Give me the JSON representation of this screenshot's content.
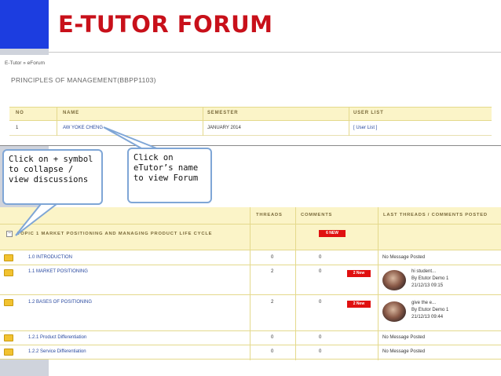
{
  "slide": {
    "title": "E-TUTOR FORUM"
  },
  "forum_page": {
    "breadcrumb": "E-Tutor » eForum",
    "course_title": "PRINCIPLES OF MANAGEMENT(BBPP1103)",
    "columns": [
      "NO",
      "NAME",
      "SEMESTER",
      "USER LIST"
    ],
    "rows": [
      {
        "no": "1",
        "name": "AW YOKE CHENG",
        "semester": "JANUARY 2014",
        "user_list": "[ User List ]"
      }
    ]
  },
  "topic_page": {
    "columns": {
      "threads": "THREADS",
      "comments": "COMMENTS",
      "last": "LAST THREADS / COMMENTS POSTED"
    },
    "topic": {
      "label": "TOPIC 1 MARKET POSITIONING AND MANAGING PRODUCT LIFE CYCLE",
      "badge": "6 NEW"
    },
    "subtopics": [
      {
        "name": "1.0 INTRODUCTION",
        "threads": "0",
        "comments": "0",
        "badge": "",
        "last": [
          "No Message Posted"
        ]
      },
      {
        "name": "1.1 MARKET POSITIONING",
        "threads": "2",
        "comments": "0",
        "badge": "2 New",
        "last": [
          "hi student...",
          "By Etutor Demo 1",
          "21/12/13 09:15"
        ]
      },
      {
        "name": "1.2 BASES OF POSITIONING",
        "threads": "2",
        "comments": "0",
        "badge": "2 New",
        "last": [
          "give the e...",
          "By Etutor Demo 1",
          "21/12/13 09:44"
        ]
      },
      {
        "name": "1.2.1 Product Differentiation",
        "threads": "0",
        "comments": "0",
        "badge": "",
        "last": [
          "No Message Posted"
        ]
      },
      {
        "name": "1.2.2 Service Differentiation",
        "threads": "0",
        "comments": "0",
        "badge": "",
        "last": [
          "No Message Posted"
        ]
      }
    ]
  },
  "callouts": {
    "left": "Click on + symbol to collapse / view discussions",
    "right": "Click on eTutor’s name to view Forum"
  },
  "colors": {
    "title": "#c8101a",
    "accent_blue": "#1c3de0",
    "header_bg": "#fbf4c8",
    "new_badge": "#e01010"
  }
}
